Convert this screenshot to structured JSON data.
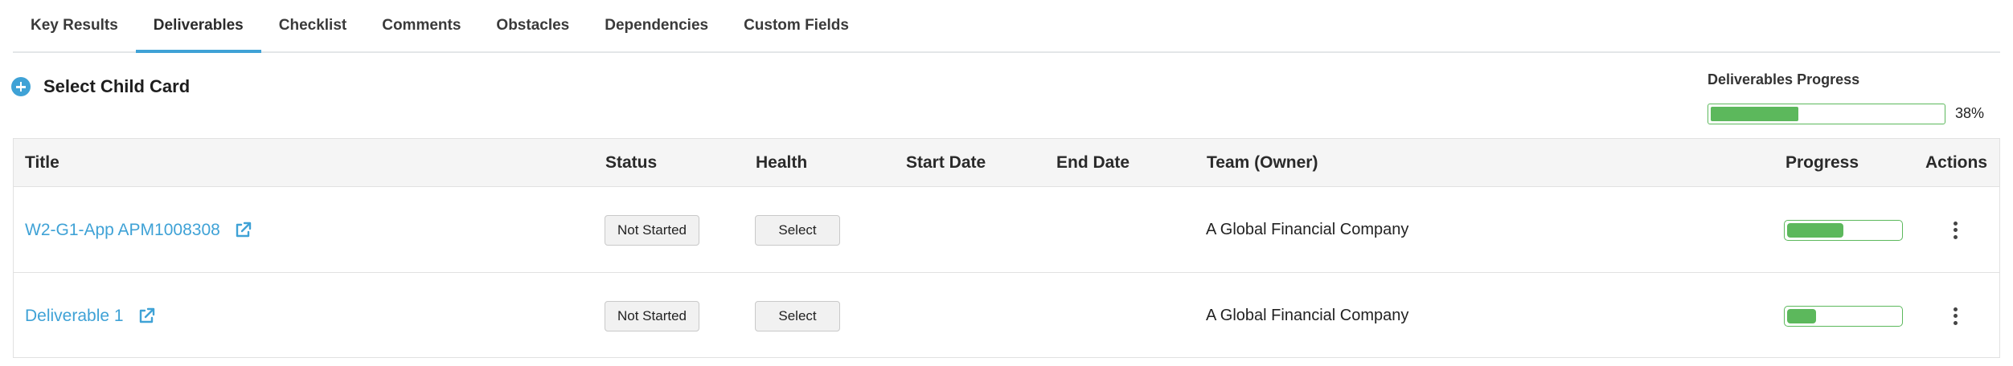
{
  "tabs": [
    {
      "label": "Key Results",
      "active": false
    },
    {
      "label": "Deliverables",
      "active": true
    },
    {
      "label": "Checklist",
      "active": false
    },
    {
      "label": "Comments",
      "active": false
    },
    {
      "label": "Obstacles",
      "active": false
    },
    {
      "label": "Dependencies",
      "active": false
    },
    {
      "label": "Custom Fields",
      "active": false
    }
  ],
  "select_child_card": {
    "label": "Select Child Card",
    "icon": "plus-circle-icon"
  },
  "deliverables_progress": {
    "title": "Deliverables Progress",
    "value": 38,
    "label": "38%"
  },
  "table": {
    "columns": [
      "Title",
      "Status",
      "Health",
      "Start Date",
      "End Date",
      "Team (Owner)",
      "Progress",
      "Actions"
    ],
    "rows": [
      {
        "title": "W2-G1-App APM1008308",
        "status": "Not Started",
        "health": "Select",
        "start_date": "",
        "end_date": "",
        "team": "A Global Financial Company",
        "progress": 0.5
      },
      {
        "title": "Deliverable 1",
        "status": "Not Started",
        "health": "Select",
        "start_date": "",
        "end_date": "",
        "team": "A Global Financial Company",
        "progress": 0.26
      }
    ]
  },
  "colors": {
    "accent": "#3fa2d6",
    "progress": "#5cb85c"
  }
}
